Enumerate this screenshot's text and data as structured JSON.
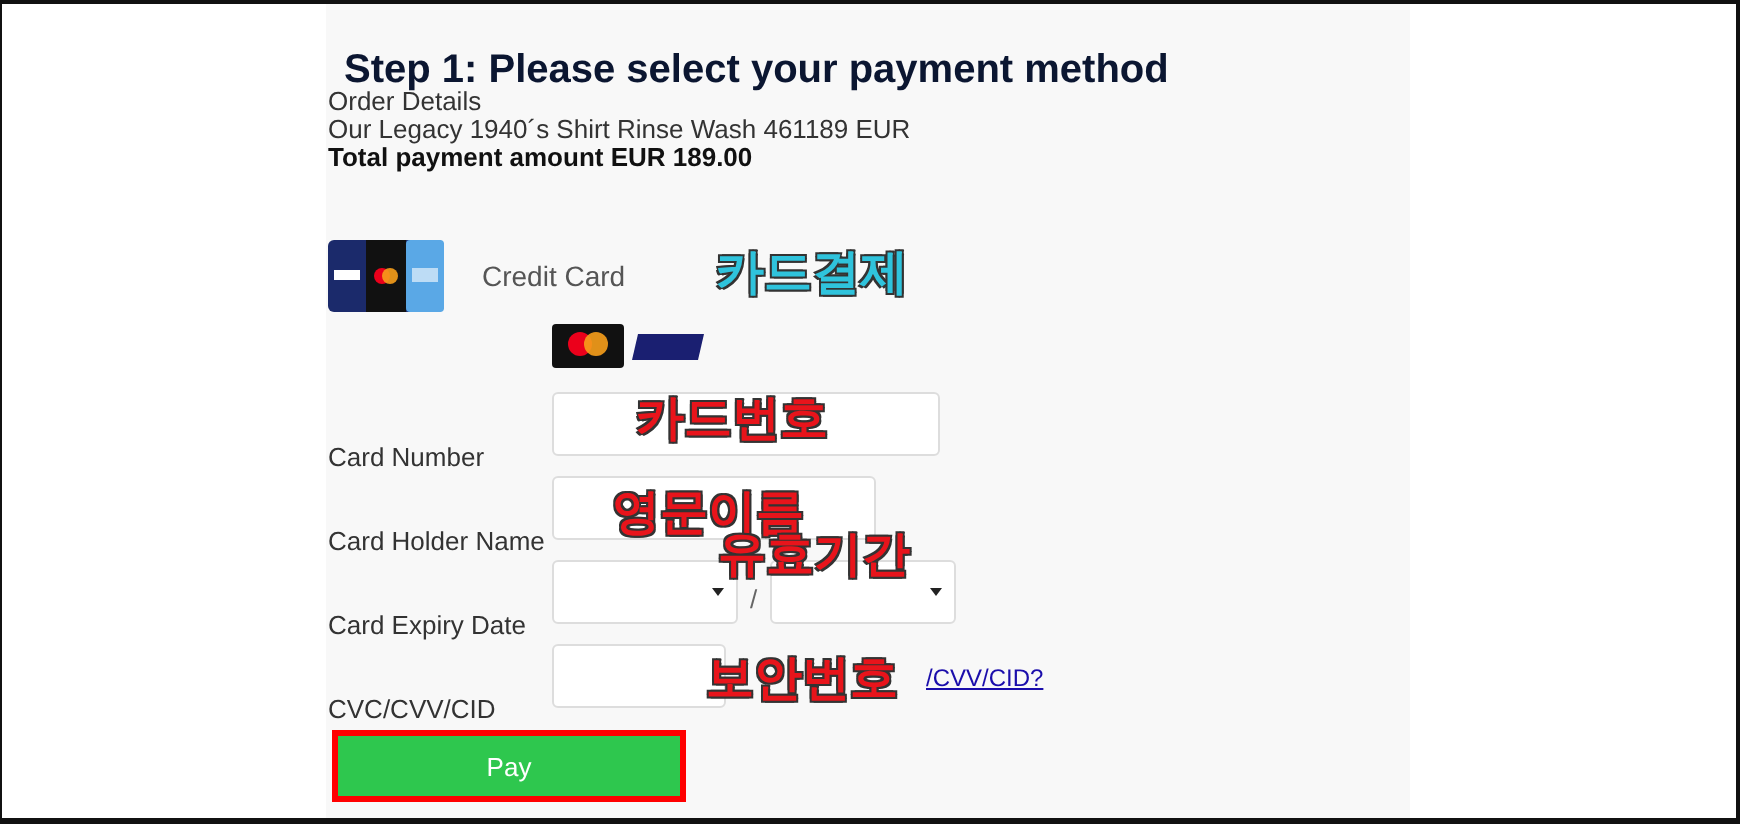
{
  "heading": "Step 1: Please select your payment method",
  "order": {
    "label": "Order Details",
    "item": "Our Legacy 1940´s Shirt Rinse Wash 461189 EUR",
    "total": "Total payment amount EUR 189.00"
  },
  "payment_method": {
    "label": "Credit Card"
  },
  "fields": [
    {
      "kind": "text",
      "label": "Card Number"
    },
    {
      "kind": "text",
      "label": "Card Holder Name"
    },
    {
      "kind": "expiry",
      "label": "Card Expiry Date",
      "separator": "/"
    },
    {
      "kind": "cvc",
      "label": "CVC/CVV/CID",
      "link": "/CVV/CID?"
    }
  ],
  "pay_button": "Pay",
  "annotations": [
    {
      "text": "카드결제",
      "color": "#2fc3dc"
    },
    {
      "text": "카드번호",
      "color": "#e8141b"
    },
    {
      "text": "영문이름",
      "color": "#e8141b"
    },
    {
      "text": "유효기간",
      "color": "#e8141b"
    },
    {
      "text": "보안번호",
      "color": "#e8141b"
    }
  ]
}
